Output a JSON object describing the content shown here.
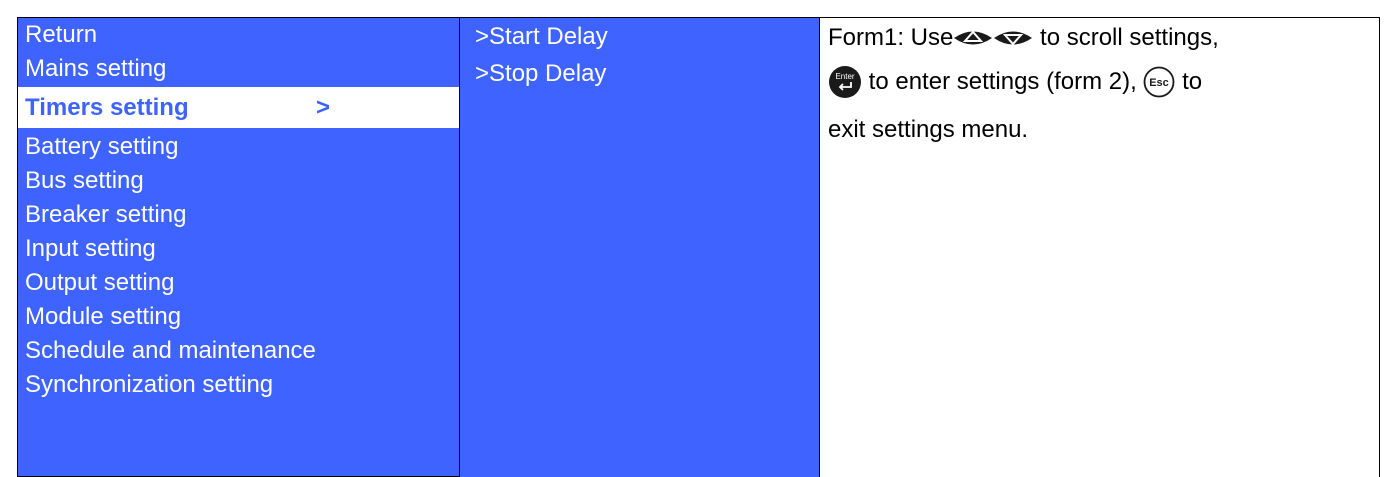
{
  "menu": {
    "items": [
      {
        "label": "Return"
      },
      {
        "label": "Mains setting"
      },
      {
        "label": "Timers setting",
        "selected": true,
        "arrow": ">"
      },
      {
        "label": "Battery setting"
      },
      {
        "label": "Bus setting"
      },
      {
        "label": "Breaker setting"
      },
      {
        "label": "Input setting"
      },
      {
        "label": "Output setting"
      },
      {
        "label": "Module setting"
      },
      {
        "label": "Schedule and maintenance"
      },
      {
        "label": "Synchronization setting"
      }
    ]
  },
  "submenu": {
    "items": [
      {
        "label": ">Start Delay"
      },
      {
        "label": ">Stop Delay"
      }
    ]
  },
  "help": {
    "line1_prefix": "Form1: Use",
    "line1_suffix": " to scroll settings,",
    "line2_middle": " to enter settings (form 2), ",
    "line2_suffix": " to",
    "line3": "exit settings menu.",
    "enter_key_label": "Enter",
    "esc_key_label": "Esc"
  },
  "colors": {
    "menu_bg": "#3f63ff",
    "menu_text": "#ffffff",
    "selected_bg": "#ffffff",
    "selected_text": "#3f63ff"
  },
  "icons": [
    "up-arrow-key-icon",
    "down-arrow-key-icon",
    "enter-key-icon",
    "esc-key-icon"
  ]
}
